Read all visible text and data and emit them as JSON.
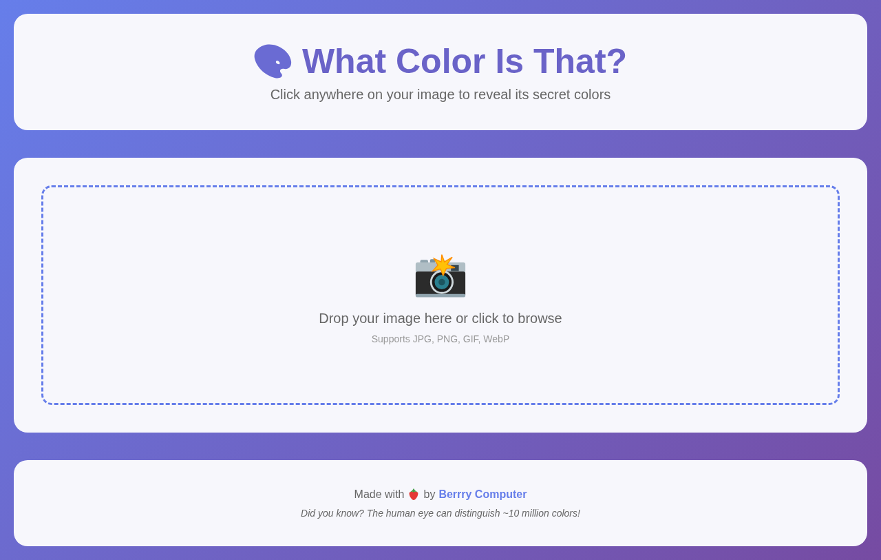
{
  "header": {
    "title": "What Color Is That?",
    "subtitle": "Click anywhere on your image to reveal its secret colors"
  },
  "upload": {
    "prompt": "Drop your image here or click to browse",
    "formats": "Supports JPG, PNG, GIF, WebP"
  },
  "footer": {
    "made_with": "Made with",
    "by": "by",
    "link": "Berrry Computer",
    "fact": "Did you know? The human eye can distinguish ~10 million colors!"
  }
}
